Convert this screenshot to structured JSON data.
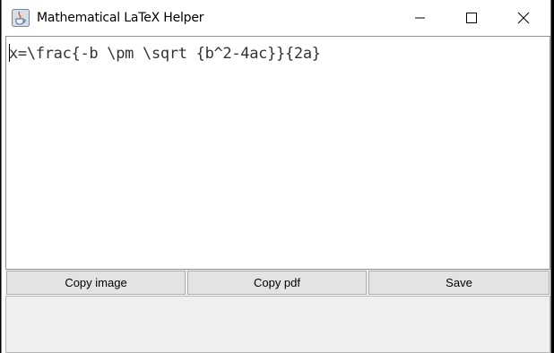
{
  "window": {
    "title": "Mathematical LaTeX Helper",
    "app_icon": "java-cup-icon",
    "controls": [
      "minimize-icon",
      "maximize-icon",
      "close-icon"
    ]
  },
  "editor": {
    "content": "x=\\frac{-b \\pm \\sqrt {b^2-4ac}}{2a}"
  },
  "buttons": {
    "copy_image": "Copy image",
    "copy_pdf": "Copy pdf",
    "save": "Save"
  },
  "colors": {
    "window_bg": "#ffffff",
    "button_bg": "#e3e3e3",
    "panel_bg": "#efefef"
  }
}
